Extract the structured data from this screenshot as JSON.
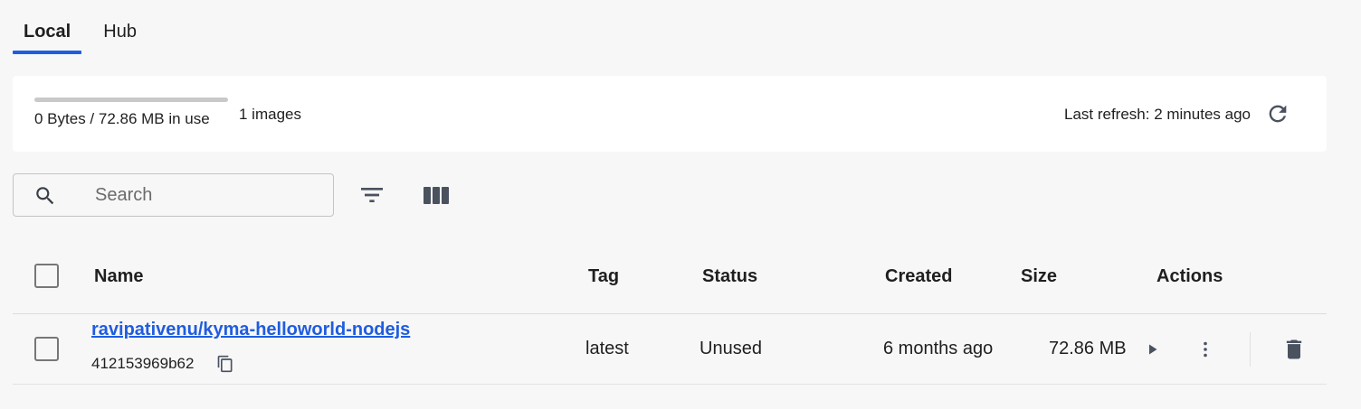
{
  "tabs": [
    {
      "label": "Local",
      "active": true
    },
    {
      "label": "Hub",
      "active": false
    }
  ],
  "summary": {
    "usage_text": "0 Bytes / 72.86 MB in use",
    "usage_fraction": 0.0,
    "image_count": "1 images",
    "last_refresh": "Last refresh: 2 minutes ago",
    "refresh_icon": "refresh-icon"
  },
  "search": {
    "placeholder": "Search",
    "value": ""
  },
  "toolbar": {
    "filter_icon": "filter-icon",
    "columns_icon": "columns-icon"
  },
  "table": {
    "columns": {
      "name": "Name",
      "tag": "Tag",
      "status": "Status",
      "created": "Created",
      "size": "Size",
      "actions": "Actions"
    },
    "rows": [
      {
        "name": "ravipativenu/kyma-helloworld-nodejs",
        "id": "412153969b62",
        "tag": "latest",
        "status": "Unused",
        "created": "6 months ago",
        "size": "72.86 MB",
        "actions": [
          "run-icon",
          "more-vert-icon",
          "delete-icon"
        ]
      }
    ]
  },
  "colors": {
    "accent": "#1f5ce0",
    "background": "#f7f7f7",
    "card": "#ffffff"
  }
}
